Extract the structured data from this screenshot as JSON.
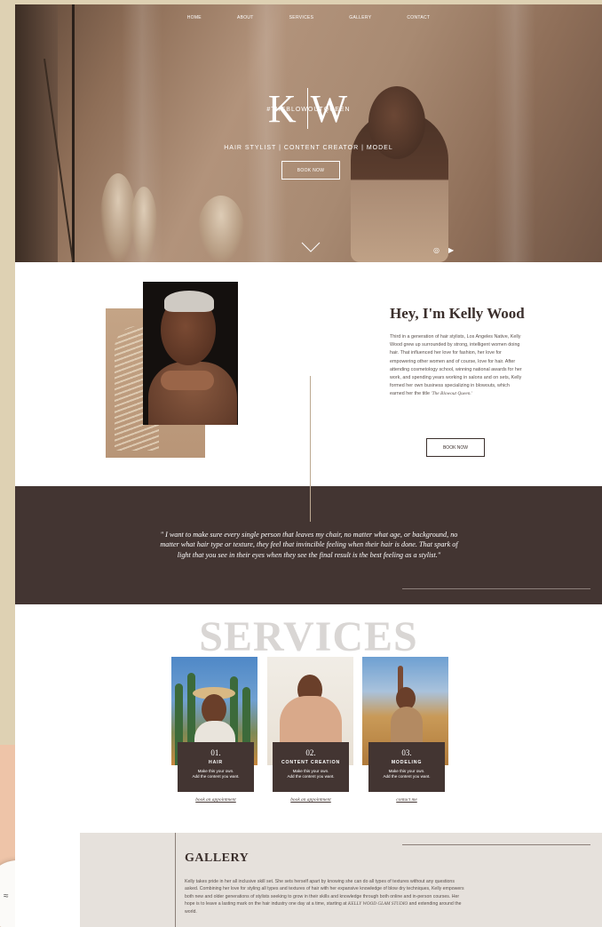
{
  "nav": {
    "items": [
      "HOME",
      "ABOUT",
      "SERVICES",
      "GALLERY",
      "CONTACT"
    ]
  },
  "hero": {
    "logo_left": "K",
    "logo_right": "W",
    "hashtag": "#THEBLOWOUTQUEEN",
    "tagline": "HAIR STYLIST | CONTENT CREATOR | MODEL",
    "book_label": "BOOK NOW",
    "social_icons": [
      "instagram-icon",
      "youtube-icon"
    ]
  },
  "about": {
    "title": "Hey, I'm Kelly Wood",
    "paragraph": "Third in a generation of hair stylists, Los Angeles Native, Kelly Wood grew up surrounded by strong, intelligent women doing hair. That influenced her love for fashion, her love for empowering other women and of course, love for hair. After attending cosmetology school, winning national awards for her work, and spending years working in salons and on sets, Kelly formed her own business specializing in blowouts, which earned her the title ",
    "title_quote": "'The Blowout Queen.'",
    "book_label": "BOOK NOW"
  },
  "quote": {
    "text": "\" I want to make sure every single person that leaves my chair, no matter what age, or background, no matter what hair type or texture, they feel that invincible feeling when their hair is done. That spark of light that you see in their eyes when they see the final result is the best feeling as a stylist.\""
  },
  "services": {
    "heading": "SERVICES",
    "items": [
      {
        "number": "01.",
        "name": "HAIR",
        "desc_line1": "Make this your own.",
        "desc_line2": "Add the content you want.",
        "link": "book an appointment"
      },
      {
        "number": "02.",
        "name": "CONTENT CREATION",
        "desc_line1": "Make this your own.",
        "desc_line2": "Add the content you want.",
        "link": "book an appointment"
      },
      {
        "number": "03.",
        "name": "MODELING",
        "desc_line1": "Make this your own.",
        "desc_line2": "Add the content you want.",
        "link": "contact me"
      }
    ]
  },
  "gallery": {
    "title": "GALLERY",
    "paragraph": "Kelly takes pride in her all inclusive skill set. She sets herself apart by knowing she can do all types of textures without any questions asked. Combining her love for styling all types and textures of hair with her expansive knowledge of blow dry techniques, Kelly empowers both new and older generations of stylists seeking to grow in their skills and knowledge through both online and in-person courses. Her hope is to leave a lasting mark on the hair industry one day at a time, starting at ",
    "studio_name": "KELLY WOOD GLAM STUDIO",
    "paragraph_end": " and extending around the world."
  },
  "colors": {
    "brown_band": "#433532",
    "gallery_bg": "#e6e1dc",
    "accent_text": "#3b2f2c"
  }
}
